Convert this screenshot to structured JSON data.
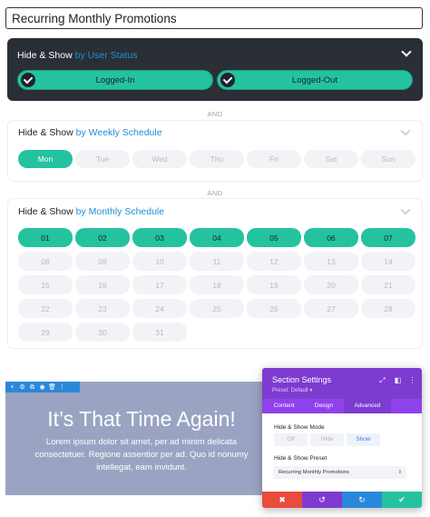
{
  "preset_name": "Recurring Monthly Promotions",
  "user_status": {
    "title_prefix": "Hide & Show",
    "title_accent": "by User Status",
    "options": [
      {
        "label": "Logged-In",
        "checked": true
      },
      {
        "label": "Logged-Out",
        "checked": true
      }
    ]
  },
  "and_label": "AND",
  "weekly": {
    "title_prefix": "Hide & Show",
    "title_accent": "by Weekly Schedule",
    "days": [
      {
        "label": "Mon",
        "selected": true
      },
      {
        "label": "Tue",
        "selected": false
      },
      {
        "label": "Wed",
        "selected": false
      },
      {
        "label": "Thu",
        "selected": false
      },
      {
        "label": "Fri",
        "selected": false
      },
      {
        "label": "Sat",
        "selected": false
      },
      {
        "label": "Sun",
        "selected": false
      }
    ]
  },
  "monthly": {
    "title_prefix": "Hide & Show",
    "title_accent": "by Monthly Schedule",
    "dates": [
      {
        "label": "01",
        "selected": true
      },
      {
        "label": "02",
        "selected": true
      },
      {
        "label": "03",
        "selected": true
      },
      {
        "label": "04",
        "selected": true
      },
      {
        "label": "05",
        "selected": true
      },
      {
        "label": "06",
        "selected": true
      },
      {
        "label": "07",
        "selected": true
      },
      {
        "label": "08",
        "selected": false
      },
      {
        "label": "09",
        "selected": false
      },
      {
        "label": "10",
        "selected": false
      },
      {
        "label": "11",
        "selected": false
      },
      {
        "label": "12",
        "selected": false
      },
      {
        "label": "13",
        "selected": false
      },
      {
        "label": "14",
        "selected": false
      },
      {
        "label": "15",
        "selected": false
      },
      {
        "label": "16",
        "selected": false
      },
      {
        "label": "17",
        "selected": false
      },
      {
        "label": "18",
        "selected": false
      },
      {
        "label": "19",
        "selected": false
      },
      {
        "label": "20",
        "selected": false
      },
      {
        "label": "21",
        "selected": false
      },
      {
        "label": "22",
        "selected": false
      },
      {
        "label": "23",
        "selected": false
      },
      {
        "label": "24",
        "selected": false
      },
      {
        "label": "25",
        "selected": false
      },
      {
        "label": "26",
        "selected": false
      },
      {
        "label": "27",
        "selected": false
      },
      {
        "label": "28",
        "selected": false
      },
      {
        "label": "29",
        "selected": false
      },
      {
        "label": "30",
        "selected": false
      },
      {
        "label": "31",
        "selected": false
      }
    ]
  },
  "preview": {
    "heading": "It’s That Time Again!",
    "body": "Lorem ipsum dolor sit amet, per ad minim delicata consectetuer. Regione assentior per ad. Quo id nonumy intellegat, eam invidunt."
  },
  "settings_panel": {
    "title": "Section Settings",
    "preset": "Preset: Default ▾",
    "tabs": [
      "Content",
      "Design",
      "Advanced"
    ],
    "active_tab": "Advanced",
    "mode_label": "Hide & Show Mode",
    "modes": [
      "Off",
      "Hide",
      "Show"
    ],
    "active_mode": "Show",
    "preset_label": "Hide & Show Preset",
    "preset_value": "Recurring Monthly Promotions"
  },
  "colors": {
    "accent_green": "#25c2a0",
    "dark_card": "#2a2f36",
    "link_blue": "#1f8fd6",
    "purple": "#7e3bd0",
    "footer_cancel": "#e74c3c",
    "footer_undo": "#7e3bd0",
    "footer_redo": "#2b87da",
    "footer_save": "#25c2a0"
  },
  "icons": {
    "toolbar": [
      "plus-icon",
      "gear-icon",
      "duplicate-icon",
      "eye-icon",
      "trash-icon",
      "more-icon"
    ],
    "panel_header": [
      "expand-icon",
      "split-icon",
      "more-icon"
    ],
    "footer": [
      "close-icon",
      "undo-icon",
      "redo-icon",
      "check-icon"
    ]
  }
}
